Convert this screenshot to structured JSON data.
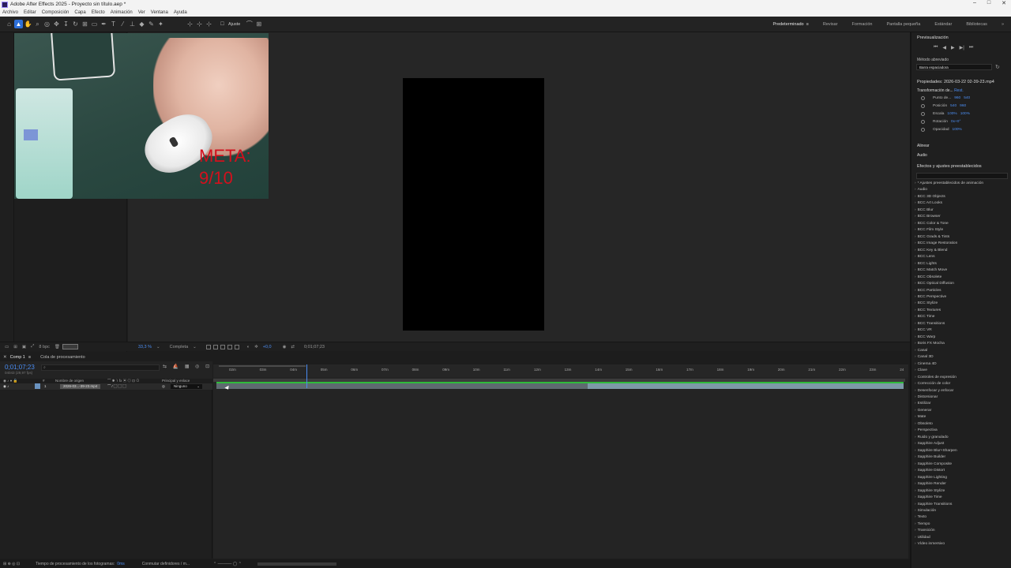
{
  "window": {
    "title": "Adobe After Effects 2025 - Proyecto sin título.aep *",
    "controls": [
      "–",
      "□",
      "✕"
    ]
  },
  "menu": [
    "Archivo",
    "Editar",
    "Composición",
    "Capa",
    "Efecto",
    "Animación",
    "Ver",
    "Ventana",
    "Ayuda"
  ],
  "toolbar": {
    "snap_label": "Ajuste"
  },
  "workspaces": [
    "Predeterminado",
    "Revisar",
    "Formación",
    "Pantalla pequeña",
    "Estándar",
    "Bibliotecas"
  ],
  "overlay": {
    "meta_line1": "META:",
    "meta_line2": "9/10"
  },
  "viewer_footer": {
    "bpc": "8 bpc",
    "zoom": "33,3 %",
    "resolution": "Completa",
    "exposure": "+0,0",
    "timecode": "0;01;07;23"
  },
  "timeline": {
    "tabs": [
      "Comp 1",
      "Cola de procesamiento"
    ],
    "timecode": "0;01;07;23",
    "fps": "04043 (29,97 fps)",
    "col_source": "Nombre de origen",
    "col_parent": "Principal y enlace",
    "layer": {
      "index": "1",
      "name": "2026-03...-39-23.mp4",
      "parent": "Ninguno"
    },
    "ruler": [
      "02m",
      "03m",
      "04m",
      "05m",
      "06m",
      "07m",
      "08m",
      "09m",
      "10m",
      "11m",
      "12m",
      "13m",
      "14m",
      "15m",
      "16m",
      "17m",
      "18m",
      "19m",
      "20m",
      "21m",
      "22m",
      "23m",
      "24"
    ]
  },
  "status": {
    "render_time": "Tiempo de procesamiento de los fotogramas:",
    "render_value": "0ms",
    "toggle": "Conmutar definidores / m..."
  },
  "preview": {
    "title": "Previsualización",
    "shortcut_label": "Método abreviado",
    "shortcut_value": "Barra espaciadora"
  },
  "properties": {
    "title": "Propiedades: 2026-03-22 02-39-23.mp4",
    "transform": "Transformación de...",
    "reset": "Rest.",
    "rows": [
      {
        "label": "Punto de...",
        "v1": "960",
        "v2": "540"
      },
      {
        "label": "Posición",
        "v1": "540",
        "v2": "960"
      },
      {
        "label": "Escala",
        "v1": "100%",
        "v2": "100%"
      },
      {
        "label": "Rotación",
        "v1": "0x+0°",
        "v2": ""
      },
      {
        "label": "Opacidad",
        "v1": "100%",
        "v2": ""
      }
    ],
    "align": "Alinear",
    "audio": "Audio"
  },
  "effects": {
    "title": "Efectos y ajustes preestablecidos",
    "items": [
      "* Ajustes preestablecidos de animación",
      "Audio",
      "BCC 3D Objects",
      "BCC Art Looks",
      "BCC Blur",
      "BCC Browser",
      "BCC Color & Tone",
      "BCC Film Style",
      "BCC Grads & Tints",
      "BCC Image Restoration",
      "BCC Key & Blend",
      "BCC Lens",
      "BCC Lights",
      "BCC Match Move",
      "BCC Obsolete",
      "BCC Optical Diffusion",
      "BCC Particles",
      "BCC Perspective",
      "BCC Stylize",
      "BCC Textures",
      "BCC Time",
      "BCC Transitions",
      "BCC VR",
      "BCC Warp",
      "Boris FX Mocha",
      "Canal",
      "Canal 3D",
      "Cinema 4D",
      "Clave",
      "Controles de expresión",
      "Corrección de color",
      "Desenfocar y enfocar",
      "Distorsionar",
      "Estilizar",
      "Generar",
      "Mate",
      "Obsoleto",
      "Perspectiva",
      "Ruido y granulado",
      "Sapphire Adjust",
      "Sapphire Blur+Sharpen",
      "Sapphire Builder",
      "Sapphire Composite",
      "Sapphire Distort",
      "Sapphire Lighting",
      "Sapphire Render",
      "Sapphire Stylize",
      "Sapphire Time",
      "Sapphire Transitions",
      "Simulación",
      "Texto",
      "Tiempo",
      "Transición",
      "Utilidad",
      "Vídeo inmersivo"
    ]
  }
}
